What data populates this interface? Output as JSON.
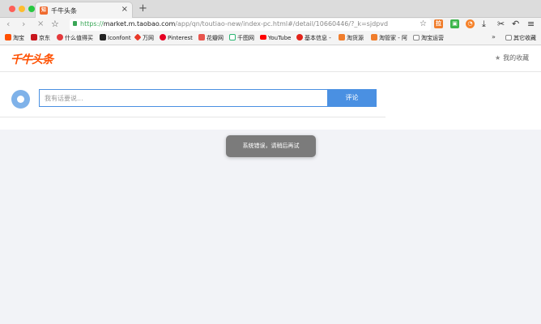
{
  "browser": {
    "tab": {
      "favicon": "知",
      "title": "千牛头条",
      "close": "×"
    },
    "new_tab": "+",
    "nav": {
      "back": "‹",
      "forward": "›",
      "stop": "×",
      "bookmark_star": "☆"
    },
    "url": {
      "scheme": "https://",
      "host": "market.m.taobao.com",
      "path": "/app/qn/toutiao-new/index-pc.html#/detail/10660446/?_k=sjdpvd"
    },
    "address_star": "☆",
    "extensions": [
      {
        "name": "ext-orange-icon",
        "glyph": "拉",
        "color": "#f07d2c"
      },
      {
        "name": "ext-green-icon",
        "glyph": "▣",
        "color": "#3bb54a"
      },
      {
        "name": "ext-alarm-icon",
        "glyph": "◔",
        "color": "#f6822a"
      }
    ],
    "toolbar": {
      "download": "⤓",
      "cut": "✂",
      "undo": "↶",
      "menu": "≡"
    }
  },
  "bookmarks": {
    "items": [
      {
        "label": "淘宝",
        "color": "#ff5000"
      },
      {
        "label": "京东",
        "color": "#c8161d"
      },
      {
        "label": "什么值得买",
        "color": "#e4393c"
      },
      {
        "label": "Iconfont",
        "color": "#222222"
      },
      {
        "label": "万网",
        "color": "#e83828"
      },
      {
        "label": "Pinterest",
        "color": "#e60023"
      },
      {
        "label": "花瓣网",
        "color": "#e8554e"
      },
      {
        "label": "千图网",
        "color": "#2bb673"
      },
      {
        "label": "YouTube",
        "color": "#ff0000"
      },
      {
        "label": "基本信息 -",
        "color": "#e2231a"
      },
      {
        "label": "淘货源",
        "color": "#f07d2c"
      },
      {
        "label": "淘管家 - 阿",
        "color": "#f07d2c"
      },
      {
        "label": "淘宝运营",
        "color": "#888888"
      }
    ],
    "more": "»",
    "other": "其它收藏"
  },
  "page": {
    "logo": "千牛头条",
    "favorites_link": "我的收藏",
    "comment": {
      "placeholder": "我有话要说...",
      "button": "评论"
    },
    "toast": "系统错误，请稍后再试"
  }
}
